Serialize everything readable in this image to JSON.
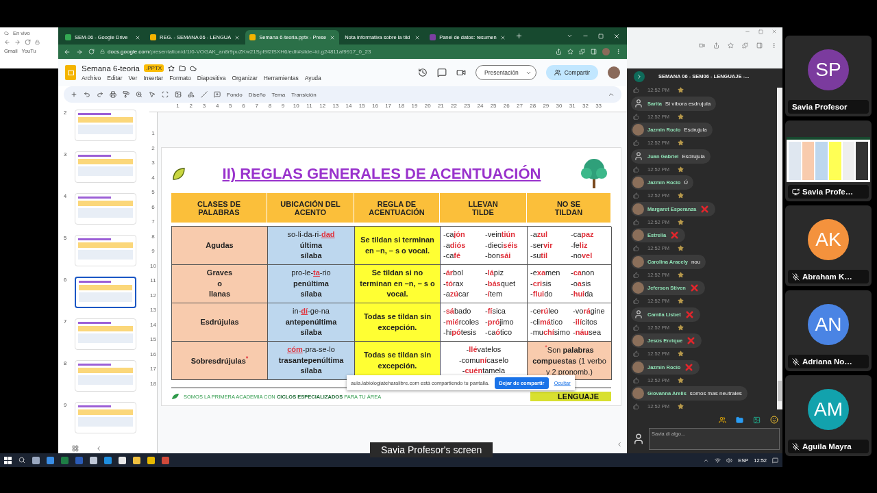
{
  "background_window": {
    "tab": "En vivo",
    "bookmarks": [
      "Gmail",
      "YouTu"
    ]
  },
  "browser": {
    "tabs": [
      {
        "label": "SEM-06 - Google Drive",
        "kind": "drive",
        "selected": false
      },
      {
        "label": "REG. - SEMANA 06 - LENGUA",
        "kind": "slides",
        "selected": false
      },
      {
        "label": "Semana 6-teoria.pptx - Prese",
        "kind": "slides",
        "selected": true
      },
      {
        "label": "Nota informativa sobre la tild",
        "kind": "none",
        "selected": false
      },
      {
        "label": "Panel de datos: resumen",
        "kind": "panel",
        "selected": false
      }
    ],
    "url_host": "docs.google.com",
    "url_path": "/presentation/d/1I0-VOGAK_an8r9puZKw21SpI9f2lSXH6/edit#slide=id.g24811af9917_0_23"
  },
  "docs": {
    "title": "Semana 6-teoria",
    "badge": ".PPTX",
    "menu": [
      "Archivo",
      "Editar",
      "Ver",
      "Insertar",
      "Formato",
      "Diapositiva",
      "Organizar",
      "Herramientas",
      "Ayuda"
    ],
    "present_button": "Presentación",
    "share_button": "Compartir",
    "toolbar": [
      "Fondo",
      "Diseño",
      "Tema",
      "Transición"
    ]
  },
  "h_ruler": [
    "1",
    "2",
    "3",
    "4",
    "5",
    "6",
    "7",
    "8",
    "9",
    "10",
    "11",
    "12",
    "13",
    "14",
    "15",
    "16",
    "17",
    "18",
    "19",
    "20",
    "21",
    "22",
    "23",
    "24",
    "25",
    "26",
    "27",
    "28",
    "29",
    "30",
    "31",
    "32",
    "33"
  ],
  "v_ruler": [
    "1",
    "2",
    "3",
    "4",
    "5",
    "6",
    "7",
    "8",
    "9",
    "10",
    "11",
    "12",
    "13",
    "14",
    "15",
    "16",
    "17",
    "18"
  ],
  "thumbnails": [
    {
      "number": "2",
      "selected": false
    },
    {
      "number": "3",
      "selected": false
    },
    {
      "number": "4",
      "selected": false
    },
    {
      "number": "5",
      "selected": false
    },
    {
      "number": "6",
      "selected": true
    },
    {
      "number": "7",
      "selected": false
    },
    {
      "number": "8",
      "selected": false
    },
    {
      "number": "9",
      "selected": false
    }
  ],
  "slide": {
    "title": "II) REGLAS GENERALES DE ACENTUACIÓN",
    "headers": [
      "CLASES DE\nPALABRAS",
      "UBICACIÓN DEL\nACENTO",
      "REGLA DE\nACENTUACIÓN",
      "LLEVAN\nTILDE",
      "NO SE\nTILDAN"
    ],
    "rows": [
      {
        "label": "Agudas",
        "syllables": "so-li-da-ri-**dad**",
        "position": "última",
        "word": "sílaba",
        "rule": "Se tildan si terminan en –n, – s o vocal.",
        "with_tilde": [
          "-ca**jón**",
          "-vein**tiún**",
          "-a**diós**",
          "-dieci**séis**",
          "-ca**fé**",
          "-bon**sái**"
        ],
        "without": {
          "kind": "words",
          "items": [
            "-a**zul**",
            "-ca**paz**",
            "-ser**vir**",
            "-fe**liz**",
            "-su**til**",
            "-no**vel**"
          ]
        }
      },
      {
        "label": "Graves\no\nllanas",
        "syllables": "pro-le-**ta**-rio",
        "position": "penúltima",
        "word": "sílaba",
        "rule": "Se tildan si no terminan en –n, – s o vocal.",
        "with_tilde": [
          "-**ár**bol",
          "-**lá**piz",
          "-**tó**rax",
          "-**bás**quet",
          "-a**zú**car",
          "-**í**tem"
        ],
        "without": {
          "kind": "words",
          "items": [
            "-e**xa**men",
            "-**ca**non",
            "-**cri**sis",
            "-o**a**sis",
            "-**flui**do",
            "-**hui**da"
          ]
        }
      },
      {
        "label": "Esdrújulas",
        "syllables": "in-**dí**-ge-na",
        "position": "antepenúltima",
        "word": "sílaba",
        "rule": "Todas se tildan sin excepción.",
        "with_tilde": [
          "-**sá**bado",
          "-**fí**sica",
          "-**mié**rcoles",
          "-**pró**jimo",
          "-hi**pó**tesis",
          "-ca**ó**tico"
        ],
        "without": {
          "kind": "words",
          "items": [
            "-ce**rú**leo",
            "-vo**rá**gine",
            "-cli**má**tico",
            "-**ilí**citos",
            "-mu**chí**simo",
            "-**náu**sea"
          ]
        }
      },
      {
        "label": "Sobresdrújulas$^{*}$",
        "syllables": "**cóm**-pra-se-lo",
        "position": "trasantepenúltima",
        "word": "sílaba",
        "rule": "Todas se tildan sin excepción.",
        "with_tilde": [
          "-**llé**vatelos",
          "-comu**ní**caselo",
          "-**cuén**tamela"
        ],
        "without": {
          "kind": "note",
          "text": "$^{*}$Son **palabras compuestas** (1 verbo y 2 pronomb.)"
        }
      }
    ],
    "footer": "SOMOS LA PRIMERA ACADEMIA CON **CICLOS ESPECIALIZADOS** PARA TU ÁREA",
    "tag": "LENGUAJE",
    "share_bar": {
      "text": "aula.labiologiateharalibre.com está compartiendo tu pantalla.",
      "stop": "Dejar de compartir",
      "hide": "Ocultar"
    }
  },
  "chat": {
    "title": "SEMANA 06 - SEM06 - LENGUAJE -...",
    "top_time": "12:52 PM",
    "messages": [
      {
        "name": "Sarita",
        "kind": "text",
        "text": "Si víbora esdrujula",
        "has_photo": false,
        "time": "12:52 PM"
      },
      {
        "name": "Jazmin Rocio",
        "kind": "text",
        "text": "Esdrujula",
        "has_photo": true,
        "time": "12:52 PM"
      },
      {
        "name": "Juan Gabriel",
        "kind": "text",
        "text": "Esdrujula",
        "has_photo": false,
        "time": "12:52 PM"
      },
      {
        "name": "Jazmin Rocio",
        "kind": "text",
        "text": "Ú",
        "has_photo": true,
        "time": "12:52 PM"
      },
      {
        "name": "Margaret Esperanza",
        "kind": "cross",
        "has_photo": true,
        "time": "12:52 PM"
      },
      {
        "name": "Estrella",
        "kind": "cross",
        "has_photo": true,
        "time": "12:52 PM"
      },
      {
        "name": "Carolina Aracely",
        "kind": "text",
        "text": "nou",
        "has_photo": true,
        "time": "12:52 PM"
      },
      {
        "name": "Jeferson Stiven",
        "kind": "cross",
        "has_photo": true,
        "time": "12:52 PM"
      },
      {
        "name": "Camila Lisbet",
        "kind": "cross",
        "has_photo": false,
        "time": "12:52 PM"
      },
      {
        "name": "Jesús Enrique",
        "kind": "cross",
        "has_photo": true,
        "time": "12:52 PM"
      },
      {
        "name": "Jazmin Rocio",
        "kind": "cross",
        "has_photo": true,
        "time": "12:52 PM"
      },
      {
        "name": "Giovanna Arelis",
        "kind": "text",
        "text": "somos mas neutrales",
        "has_photo": true,
        "time": "12:52 PM"
      }
    ],
    "input_placeholder": "Savia di algo..."
  },
  "participants": [
    {
      "kind": "avatar",
      "initials": "SP",
      "name": "Savia Profesor",
      "color": "#7b3b9e",
      "muted": false
    },
    {
      "kind": "screen",
      "name": "Savia Profe…"
    },
    {
      "kind": "avatar",
      "initials": "AK",
      "name": "Abraham K…",
      "color": "#f4923d",
      "muted": true
    },
    {
      "kind": "avatar",
      "initials": "AN",
      "name": "Adriana No…",
      "color": "#4a84e4",
      "muted": true
    },
    {
      "kind": "avatar",
      "initials": "AM",
      "name": "Aguila Mayra",
      "color": "#12a2ad",
      "muted": true
    }
  ],
  "taskbar": {
    "language": "ESP",
    "clock": "12:52"
  },
  "caption": "Savia Profesor's screen"
}
